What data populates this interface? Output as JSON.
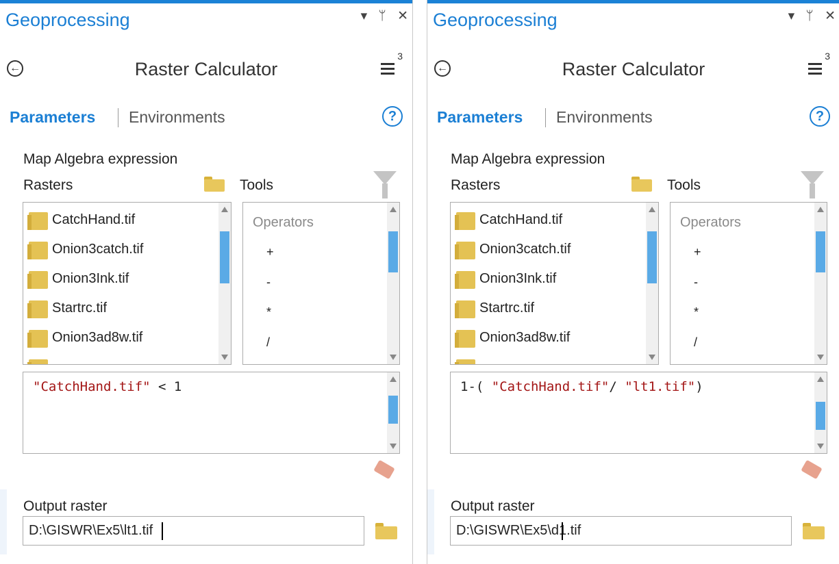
{
  "panes": [
    {
      "title": "Geoprocessing",
      "window_controls": [
        "▾",
        "ᛘ",
        "✕"
      ],
      "tool_title": "Raster Calculator",
      "menu_count": "3",
      "tabs": {
        "parameters": "Parameters",
        "environments": "Environments"
      },
      "help": "?",
      "expression_label": "Map Algebra expression",
      "rasters_label": "Rasters",
      "tools_label": "Tools",
      "rasters": [
        "CatchHand.tif",
        "Onion3catch.tif",
        "Onion3Ink.tif",
        "Startrc.tif",
        "Onion3ad8w.tif"
      ],
      "operators_header": "Operators",
      "operators": [
        "+",
        "-",
        "*",
        "/"
      ],
      "expression": {
        "prefix": "",
        "string1": "\"CatchHand.tif\"",
        "middle": " < 1",
        "string2": "",
        "suffix": ""
      },
      "output_label": "Output raster",
      "output_value": "D:\\GISWR\\Ex5\\lt1.tif",
      "raster_thumb": {
        "start": 0.12,
        "size": 0.38
      },
      "ops_thumb": {
        "start": 0.12,
        "size": 0.3
      },
      "expr_thumb": {
        "start": 0.2,
        "size": 0.5
      }
    },
    {
      "title": "Geoprocessing",
      "window_controls": [
        "▾",
        "ᛘ",
        "✕"
      ],
      "tool_title": "Raster Calculator",
      "menu_count": "3",
      "tabs": {
        "parameters": "Parameters",
        "environments": "Environments"
      },
      "help": "?",
      "expression_label": "Map Algebra expression",
      "rasters_label": "Rasters",
      "tools_label": "Tools",
      "rasters": [
        "CatchHand.tif",
        "Onion3catch.tif",
        "Onion3Ink.tif",
        "Startrc.tif",
        "Onion3ad8w.tif"
      ],
      "operators_header": "Operators",
      "operators": [
        "+",
        "-",
        "*",
        "/"
      ],
      "expression": {
        "prefix": "1-( ",
        "string1": "\"CatchHand.tif\"",
        "middle": "/ ",
        "string2": "\"lt1.tif\"",
        "suffix": ")"
      },
      "output_label": "Output raster",
      "output_value": "D:\\GISWR\\Ex5\\d1.tif",
      "raster_thumb": {
        "start": 0.12,
        "size": 0.38
      },
      "ops_thumb": {
        "start": 0.12,
        "size": 0.3
      },
      "expr_thumb": {
        "start": 0.3,
        "size": 0.5
      }
    }
  ]
}
